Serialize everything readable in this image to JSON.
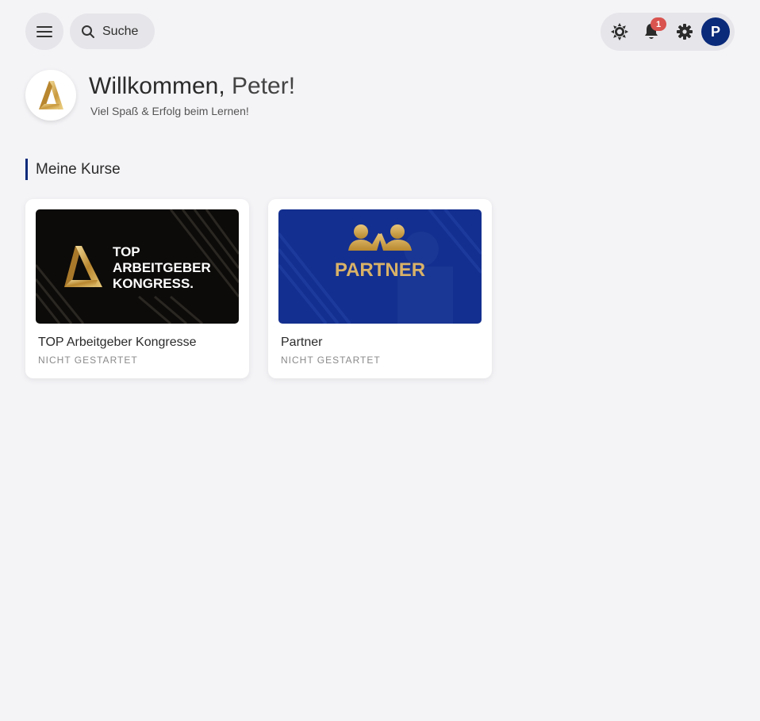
{
  "header": {
    "search_label": "Suche",
    "notification_count": "1",
    "avatar_initial": "P"
  },
  "welcome": {
    "greeting": "Willkommen,",
    "name": "Peter!",
    "subtitle": "Viel Spaß & Erfolg beim Lernen!"
  },
  "section": {
    "title": "Meine Kurse"
  },
  "courses": [
    {
      "title": "TOP Arbeitgeber Kongresse",
      "status": "NICHT GESTARTET",
      "thumb_lines": [
        "TOP",
        "ARBEITGEBER",
        "KONGRESS."
      ]
    },
    {
      "title": "Partner",
      "status": "NICHT GESTARTET",
      "thumb_text": "PARTNER"
    }
  ],
  "colors": {
    "brand_navy": "#0a2a7a",
    "badge_red": "#d9534f",
    "gold": "#d9b268"
  }
}
